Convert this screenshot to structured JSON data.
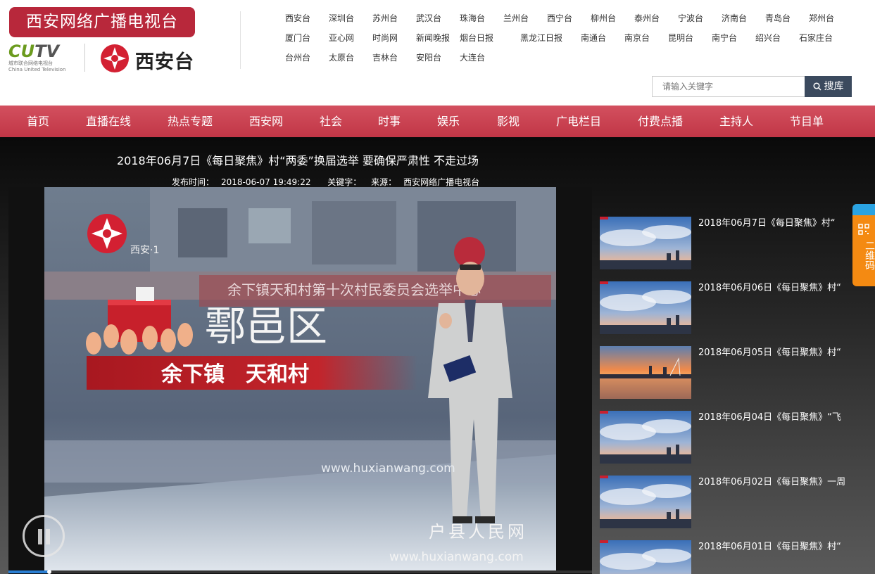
{
  "header": {
    "site_name": "西安网络广播电视台",
    "cutv_logo": {
      "main_cu": "CU",
      "main_tv": "TV",
      "sub_cn": "城市联合网络电视台",
      "sub_en": "China United Television"
    },
    "xian_logo_text": "西安台",
    "stations": [
      [
        "西安台",
        "深圳台",
        "苏州台",
        "武汉台",
        "珠海台",
        "兰州台",
        "西宁台",
        "柳州台",
        "泰州台",
        "宁波台",
        "济南台",
        "青岛台",
        "郑州台"
      ],
      [
        "厦门台",
        "亚心网",
        "时尚网",
        "新闻晚报",
        "烟台日报",
        "黑龙江日报",
        "南通台",
        "南京台",
        "昆明台",
        "南宁台",
        "绍兴台",
        "石家庄台"
      ],
      [
        "台州台",
        "太原台",
        "吉林台",
        "安阳台",
        "大连台"
      ]
    ],
    "search": {
      "placeholder": "请输入关键字",
      "button_label": "搜库"
    }
  },
  "nav": [
    "首页",
    "直播在线",
    "热点专题",
    "西安网",
    "社会",
    "时事",
    "娱乐",
    "影视",
    "广电栏目",
    "付费点播",
    "主持人",
    "节目单"
  ],
  "article": {
    "title": "2018年06月7日《每日聚焦》村“两委”换届选举 要确保严肃性 不走过场",
    "meta": {
      "publish_label": "发布时间：",
      "publish_time": "2018-06-07 19:49:22",
      "keywords_label": "关键字：",
      "source_label": "来源：",
      "source": "西安网络广播电视台"
    }
  },
  "player": {
    "channel_label": "西安·1",
    "district_caption": "鄠邑区",
    "village_caption": "余下镇　天和村",
    "banner_text": "余下镇天和村第十次村民委员会选举中心",
    "watermark_url": "www.huxianwang.com",
    "watermark_site": "户县人民网",
    "watermark_url_bottom": "www.huxianwang.com",
    "progress": 0.07
  },
  "related": [
    {
      "title": "2018年06月7日《每日聚焦》村“",
      "thumb": "sky"
    },
    {
      "title": "2018年06月06日《每日聚焦》村“",
      "thumb": "sky"
    },
    {
      "title": "2018年06月05日《每日聚焦》村“",
      "thumb": "sunset"
    },
    {
      "title": "2018年06月04日《每日聚焦》“飞",
      "thumb": "sky"
    },
    {
      "title": "2018年06月02日《每日聚焦》一周",
      "thumb": "sky"
    },
    {
      "title": "2018年06月01日《每日聚焦》村“",
      "thumb": "sky"
    }
  ],
  "qr_tab": {
    "label": "二维码",
    "icon": "qr-code-icon"
  },
  "colors": {
    "brand_red": "#b8283b",
    "nav_red": "#c13646",
    "search_button": "#3b4a5e",
    "cutv_green": "#6b9b1e",
    "qr_orange": "#f48a12",
    "qr_blue": "#2aa3e2"
  }
}
